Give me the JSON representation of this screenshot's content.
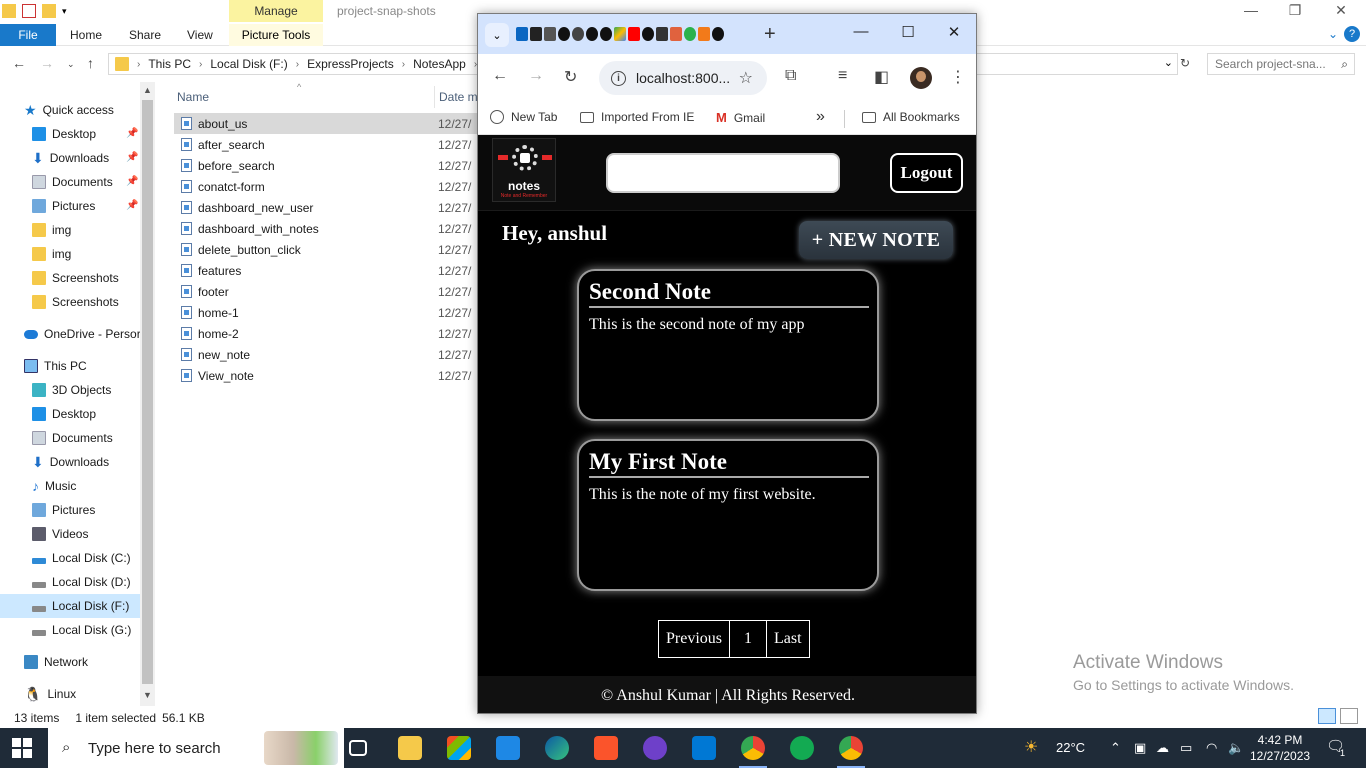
{
  "explorer": {
    "title": "project-snap-shots",
    "manage_tab": "Manage",
    "picture_tools": "Picture Tools",
    "ribbon_tabs": [
      "File",
      "Home",
      "Share",
      "View"
    ],
    "breadcrumb": [
      "This PC",
      "Local Disk (F:)",
      "ExpressProjects",
      "NotesApp"
    ],
    "search_placeholder": "Search project-sna...",
    "nav": {
      "quick_access": "Quick access",
      "qa_items": [
        "Desktop",
        "Downloads",
        "Documents",
        "Pictures",
        "img",
        "img",
        "Screenshots",
        "Screenshots"
      ],
      "onedrive": "OneDrive - Persor",
      "this_pc": "This PC",
      "pc_items": [
        "3D Objects",
        "Desktop",
        "Documents",
        "Downloads",
        "Music",
        "Pictures",
        "Videos",
        "Local Disk (C:)",
        "Local Disk (D:)",
        "Local Disk (F:)",
        "Local Disk (G:)"
      ],
      "network": "Network",
      "linux": "Linux"
    },
    "columns": {
      "name": "Name",
      "date": "Date m"
    },
    "files": [
      {
        "name": "about_us",
        "date": "12/27/"
      },
      {
        "name": "after_search",
        "date": "12/27/"
      },
      {
        "name": "before_search",
        "date": "12/27/"
      },
      {
        "name": "conatct-form",
        "date": "12/27/"
      },
      {
        "name": "dashboard_new_user",
        "date": "12/27/"
      },
      {
        "name": "dashboard_with_notes",
        "date": "12/27/"
      },
      {
        "name": "delete_button_click",
        "date": "12/27/"
      },
      {
        "name": "features",
        "date": "12/27/"
      },
      {
        "name": "footer",
        "date": "12/27/"
      },
      {
        "name": "home-1",
        "date": "12/27/"
      },
      {
        "name": "home-2",
        "date": "12/27/"
      },
      {
        "name": "new_note",
        "date": "12/27/"
      },
      {
        "name": "View_note",
        "date": "12/27/"
      }
    ],
    "status": {
      "items": "13 items",
      "selected": "1 item selected",
      "size": "56.1 KB"
    }
  },
  "browser": {
    "url": "localhost:800...",
    "bookmarks": [
      "New Tab",
      "Imported From IE",
      "Gmail",
      "All Bookmarks"
    ]
  },
  "app": {
    "logo_text": "notes",
    "logo_subtext": "Note and Remember",
    "logout": "Logout",
    "greeting": "Hey, anshul",
    "new_note": "+ NEW NOTE",
    "notes": [
      {
        "title": "Second Note",
        "body": "This is the second note of my app"
      },
      {
        "title": "My First Note",
        "body": "This is the note of my first website."
      }
    ],
    "pagination": [
      "Previous",
      "1",
      "Last"
    ],
    "footer": "© Anshul Kumar | All Rights Reserved."
  },
  "watermark": {
    "line1": "Activate Windows",
    "line2": "Go to Settings to activate Windows."
  },
  "taskbar": {
    "search_placeholder": "Type here to search",
    "weather": "22°C",
    "time": "4:42 PM",
    "date": "12/27/2023",
    "notif_count": "1"
  },
  "colors": {
    "explorer_accent": "#1979ca",
    "manage_tab": "#fbf3a0",
    "browser_tabstrip": "#d3e3fd",
    "app_bg": "#000000",
    "taskbar": "#1f2b38"
  }
}
